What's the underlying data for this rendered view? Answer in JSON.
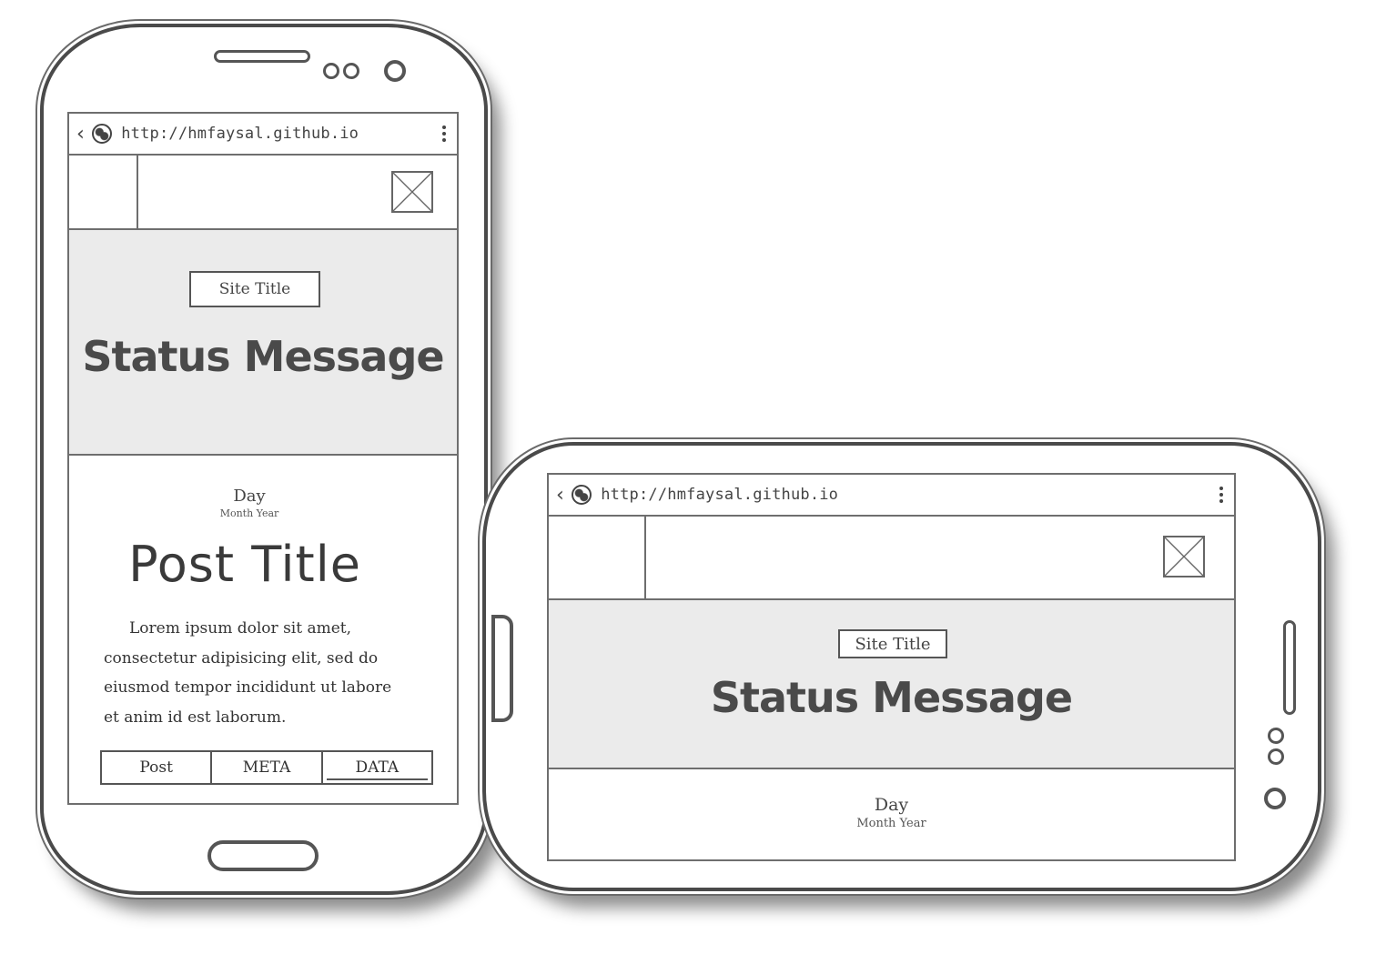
{
  "url": "http://hmfaysal.github.io",
  "site_title": "Site Title",
  "status_message": "Status Message",
  "date": {
    "day": "Day",
    "month_year": "Month Year"
  },
  "post": {
    "title": "Post Title",
    "body": "Lorem ipsum dolor sit amet, consectetur adipisicing elit, sed do eiusmod tempor incididunt ut labore et anim id est laborum."
  },
  "tabs": [
    {
      "label": "Post",
      "active": false
    },
    {
      "label": "META",
      "active": false
    },
    {
      "label": "DATA",
      "active": true
    }
  ],
  "icons": {
    "back": "chevron-left-icon",
    "site": "globe-icon",
    "menu": "kebab-menu-icon",
    "image": "image-placeholder-icon"
  },
  "colors": {
    "hero_background": "#ebebeb",
    "outline": "#555555"
  }
}
